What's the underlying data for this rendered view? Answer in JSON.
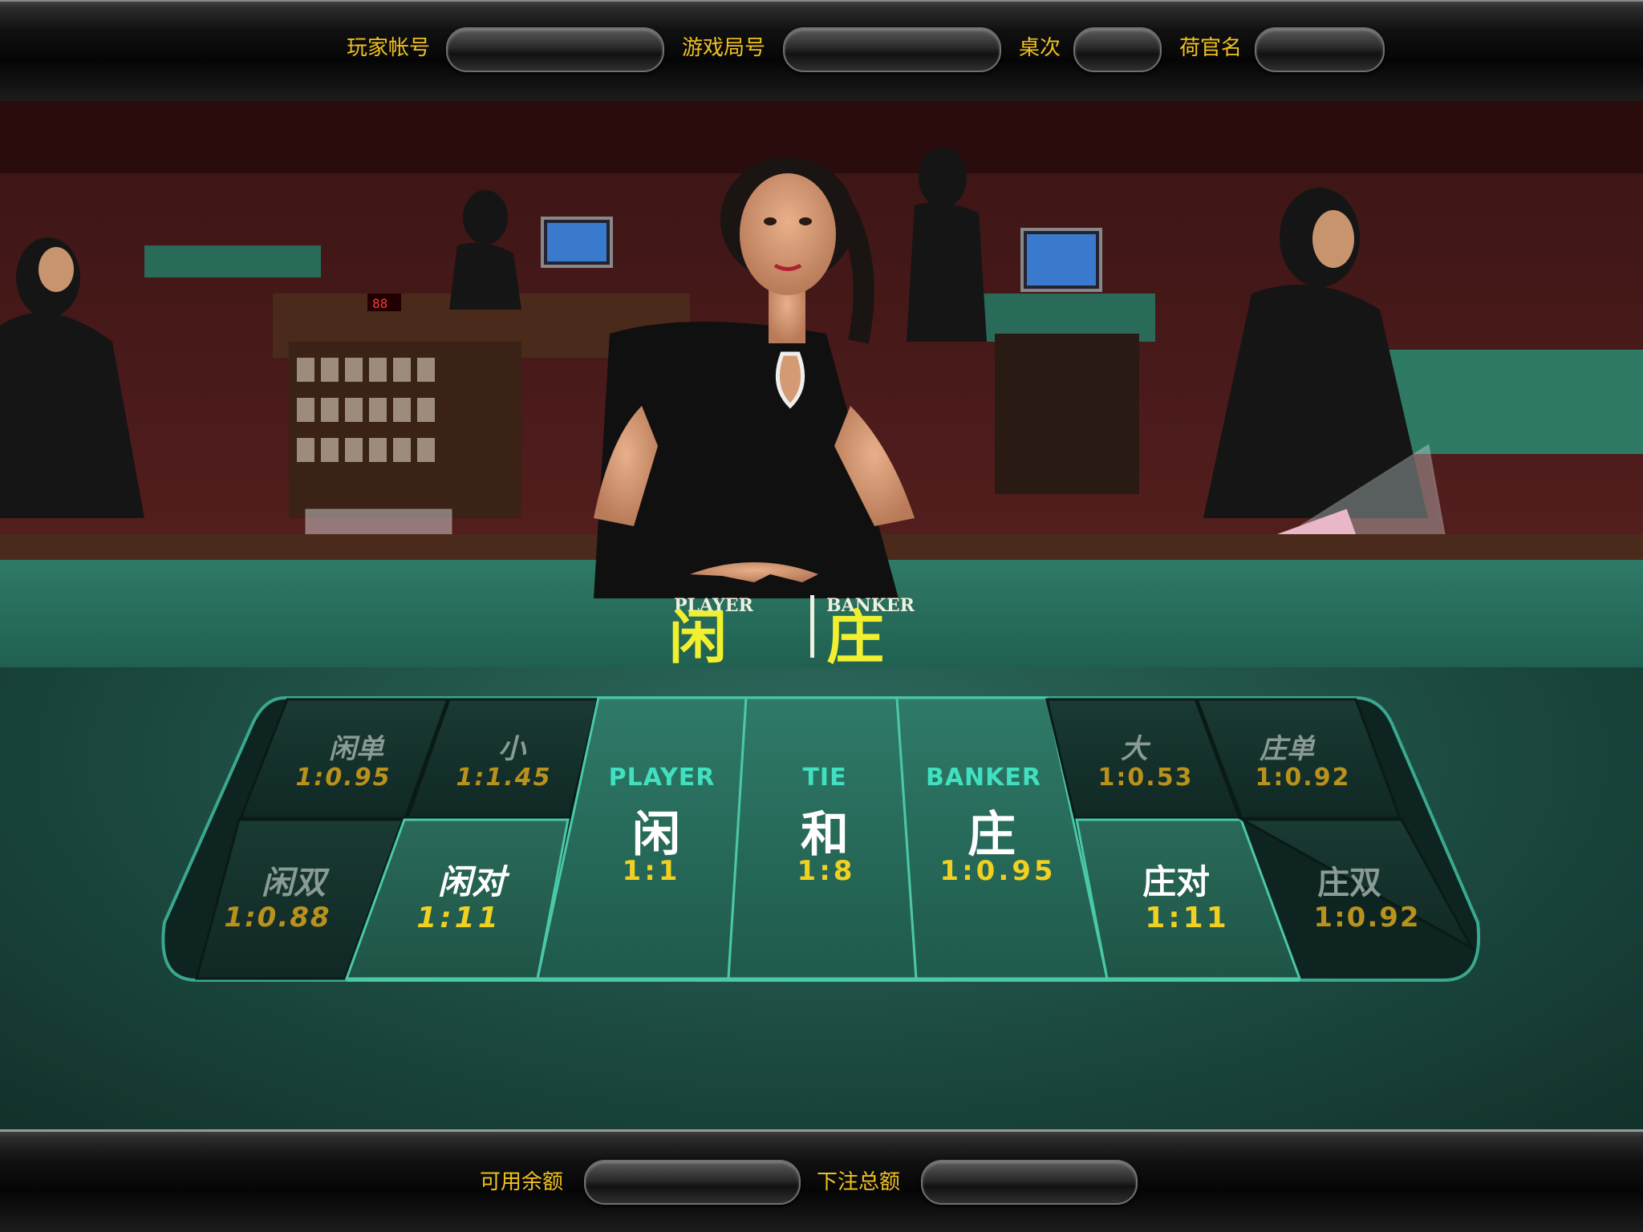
{
  "header": {
    "player_account_label": "玩家帐号",
    "player_account_value": "",
    "round_number_label": "游戏局号",
    "round_number_value": "",
    "table_label": "桌次",
    "table_value": "",
    "dealer_name_label": "荷官名",
    "dealer_name_value": ""
  },
  "video": {
    "felt_logo_player": "PLAYER",
    "felt_logo_banker": "BANKER",
    "felt_logo_player_zh": "闲",
    "felt_logo_banker_zh": "庄"
  },
  "bets": {
    "player_odd": {
      "label": "闲单",
      "odds": "1:0.95"
    },
    "small": {
      "label": "小",
      "odds": "1:1.45"
    },
    "player_even": {
      "label": "闲双",
      "odds": "1:0.88"
    },
    "player_pair": {
      "label": "闲对",
      "odds": "1:11"
    },
    "player": {
      "title": "PLAYER",
      "label": "闲",
      "odds": "1:1"
    },
    "tie": {
      "title": "TIE",
      "label": "和",
      "odds": "1:8"
    },
    "banker": {
      "title": "BANKER",
      "label": "庄",
      "odds": "1:0.95"
    },
    "big": {
      "label": "大",
      "odds": "1:0.53"
    },
    "banker_odd": {
      "label": "庄单",
      "odds": "1:0.92"
    },
    "banker_pair": {
      "label": "庄对",
      "odds": "1:11"
    },
    "banker_even": {
      "label": "庄双",
      "odds": "1:0.92"
    }
  },
  "footer": {
    "available_balance_label": "可用余额",
    "available_balance_value": "",
    "total_bet_label": "下注总额",
    "total_bet_value": ""
  },
  "colors": {
    "label_gold": "#f0c020",
    "felt_green": "#1c4a40",
    "accent_teal": "#40e0c0",
    "odds_yellow": "#f0d020"
  }
}
